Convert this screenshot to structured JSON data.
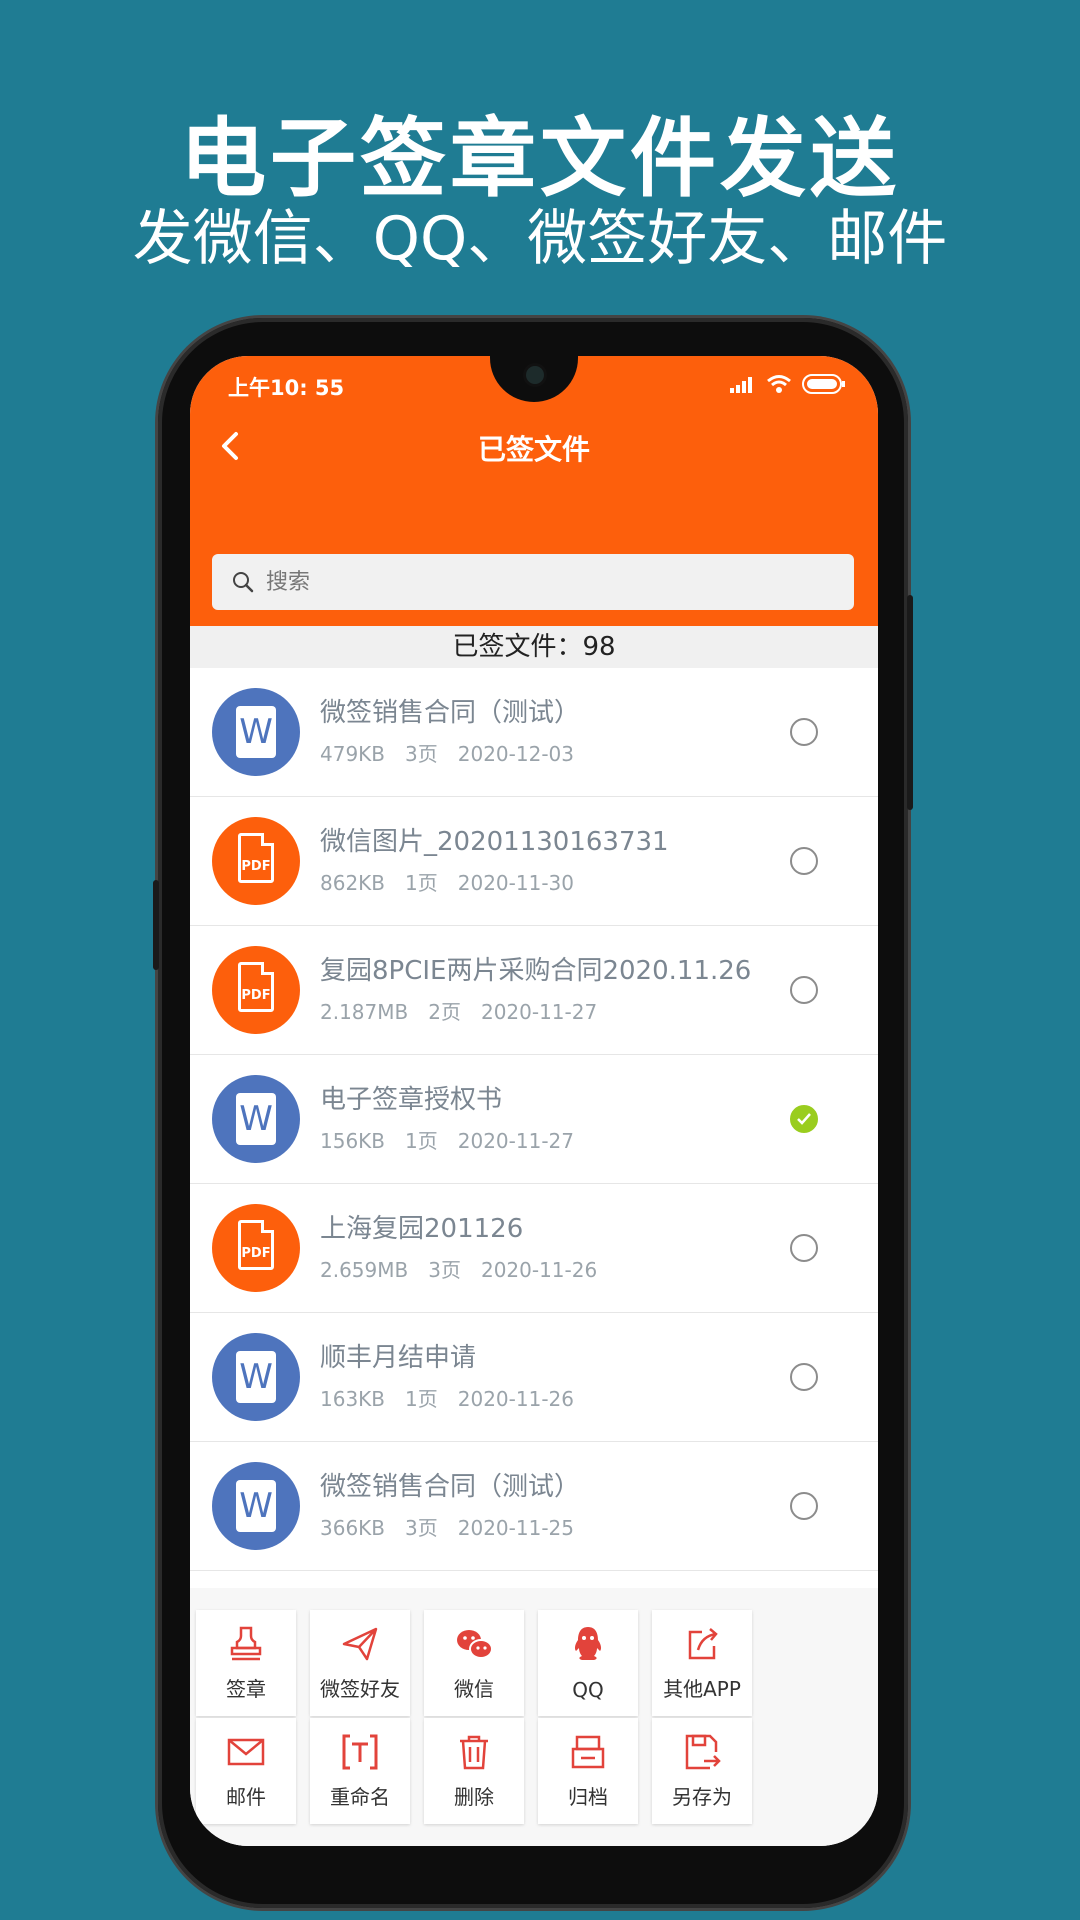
{
  "headline": "电子签章文件发送",
  "subline": "发微信、QQ、微签好友、邮件",
  "status": {
    "time": "上午10: 55"
  },
  "appbar": {
    "title": "已签文件"
  },
  "search": {
    "placeholder": "搜索"
  },
  "count": {
    "label": "已签文件：98"
  },
  "files": [
    {
      "type": "word",
      "name": "微签销售合同（测试）",
      "size": "479KB",
      "pages": "3页",
      "date": "2020-12-03",
      "checked": false
    },
    {
      "type": "pdf",
      "name": "微信图片_20201130163731",
      "size": "862KB",
      "pages": "1页",
      "date": "2020-11-30",
      "checked": false
    },
    {
      "type": "pdf",
      "name": "复园8PCIE两片采购合同2020.11.26",
      "size": "2.187MB",
      "pages": "2页",
      "date": "2020-11-27",
      "checked": false
    },
    {
      "type": "word",
      "name": "电子签章授权书",
      "size": "156KB",
      "pages": "1页",
      "date": "2020-11-27",
      "checked": true
    },
    {
      "type": "pdf",
      "name": "上海复园201126",
      "size": "2.659MB",
      "pages": "3页",
      "date": "2020-11-26",
      "checked": false
    },
    {
      "type": "word",
      "name": "顺丰月结申请",
      "size": "163KB",
      "pages": "1页",
      "date": "2020-11-26",
      "checked": false
    },
    {
      "type": "word",
      "name": "微签销售合同（测试）",
      "size": "366KB",
      "pages": "3页",
      "date": "2020-11-25",
      "checked": false
    }
  ],
  "file_icon_labels": {
    "word": "W",
    "pdf": "PDF"
  },
  "actions": [
    {
      "label": "签章",
      "icon": "stamp-icon"
    },
    {
      "label": "微签好友",
      "icon": "paper-plane-icon"
    },
    {
      "label": "微信",
      "icon": "wechat-icon"
    },
    {
      "label": "QQ",
      "icon": "qq-icon"
    },
    {
      "label": "其他APP",
      "icon": "share-icon"
    },
    {
      "label": "邮件",
      "icon": "mail-icon"
    },
    {
      "label": "重命名",
      "icon": "rename-icon"
    },
    {
      "label": "删除",
      "icon": "trash-icon"
    },
    {
      "label": "归档",
      "icon": "archive-icon"
    },
    {
      "label": "另存为",
      "icon": "save-as-icon"
    }
  ],
  "colors": {
    "brand": "#fd5f0c",
    "background": "#1f7c93",
    "word": "#4e74bd",
    "checked": "#9acd1f",
    "action_icon": "#e2433b"
  }
}
